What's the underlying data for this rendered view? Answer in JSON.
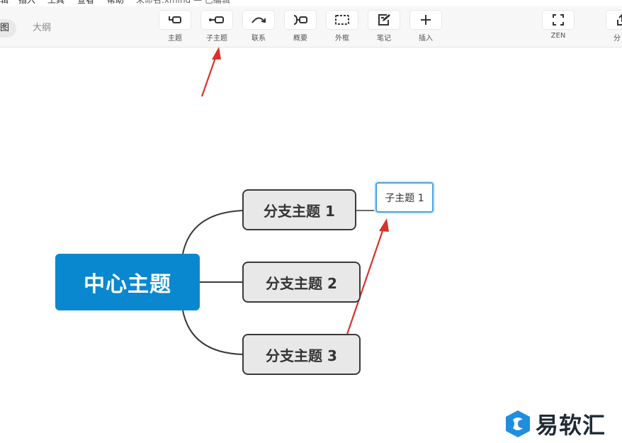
{
  "menu": {
    "items": [
      "辑",
      "插入",
      "工具",
      "查看",
      "帮助"
    ],
    "file_title": "未命名.xmind — 已编辑"
  },
  "view_tabs": [
    {
      "label": "图",
      "active": true
    },
    {
      "label": "大纲",
      "active": false
    }
  ],
  "toolbar": {
    "tools": [
      {
        "label": "主题",
        "icon": "topic-icon"
      },
      {
        "label": "子主题",
        "icon": "subtopic-icon"
      },
      {
        "label": "联系",
        "icon": "relationship-icon"
      },
      {
        "label": "概要",
        "icon": "summary-icon"
      },
      {
        "label": "外框",
        "icon": "boundary-icon"
      },
      {
        "label": "笔记",
        "icon": "note-icon"
      },
      {
        "label": "插入",
        "icon": "plus-icon"
      },
      {
        "label": "ZEN",
        "icon": "fullscreen-icon"
      },
      {
        "label": "分",
        "icon": "share-icon"
      }
    ]
  },
  "mindmap": {
    "central": "中心主题",
    "branches": [
      "分支主题 1",
      "分支主题 2",
      "分支主题 3"
    ],
    "subtopic": "子主题 1"
  },
  "colors": {
    "central_bg": "#0a88cf",
    "branch_bg": "#e8e8e8",
    "branch_border": "#3a3a3a",
    "selection": "#4aa3e0",
    "arrow": "#d8322a"
  },
  "watermark": {
    "text": "易软汇"
  }
}
